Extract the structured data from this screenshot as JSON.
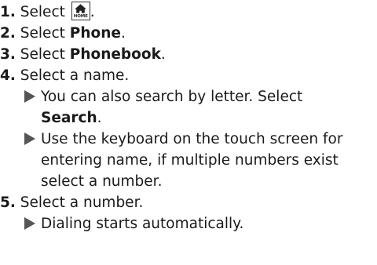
{
  "steps": [
    {
      "number": "1.",
      "text_before": "Select",
      "icon": "home-button-icon",
      "icon_label": "HOME",
      "text_after": "."
    },
    {
      "number": "2.",
      "text_before": "Select",
      "bold": "Phone",
      "text_after": "."
    },
    {
      "number": "3.",
      "text_before": "Select",
      "bold": "Phonebook",
      "text_after": "."
    },
    {
      "number": "4.",
      "text": "Select a name.",
      "notes": [
        {
          "lines": [
            "You can also search by letter. Select"
          ],
          "bold_line": "Search",
          "bold_line_after": "."
        },
        {
          "lines": [
            "Use the keyboard on the touch screen for",
            "entering name, if multiple numbers exist",
            "select a number."
          ]
        }
      ]
    },
    {
      "number": "5.",
      "text": "Select a number.",
      "notes": [
        {
          "lines": [
            "Dialing starts automatically."
          ]
        }
      ]
    }
  ],
  "colors": {
    "text": "#1a1a1a",
    "arrow": "#555555"
  }
}
